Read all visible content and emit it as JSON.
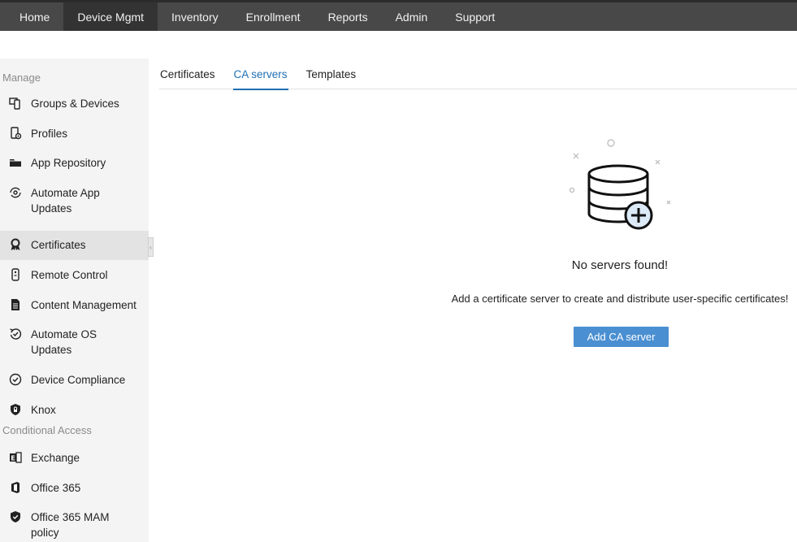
{
  "topnav": {
    "items": [
      "Home",
      "Device Mgmt",
      "Inventory",
      "Enrollment",
      "Reports",
      "Admin",
      "Support"
    ],
    "active": "Device Mgmt"
  },
  "sidebar": {
    "manage_label": "Manage",
    "manage_items": [
      {
        "label": "Groups & Devices",
        "icon": "devices-icon"
      },
      {
        "label": "Profiles",
        "icon": "profile-gear-icon"
      },
      {
        "label": "App Repository",
        "icon": "folder-icon"
      },
      {
        "label": "Automate App Updates",
        "icon": "sync-app-icon"
      },
      {
        "label": "Certificates",
        "icon": "certificate-icon"
      },
      {
        "label": "Remote Control",
        "icon": "remote-icon"
      },
      {
        "label": "Content Management",
        "icon": "document-icon"
      },
      {
        "label": "Automate OS Updates",
        "icon": "os-update-icon"
      },
      {
        "label": "Device Compliance",
        "icon": "check-circle-icon"
      },
      {
        "label": "Knox",
        "icon": "knox-shield-icon"
      }
    ],
    "conditional_label": "Conditional Access",
    "conditional_items": [
      {
        "label": "Exchange",
        "icon": "exchange-icon"
      },
      {
        "label": "Office 365",
        "icon": "office-icon"
      },
      {
        "label": "Office 365 MAM policy",
        "icon": "shield-check-icon"
      }
    ],
    "active": "Certificates"
  },
  "tabs": {
    "items": [
      "Certificates",
      "CA servers",
      "Templates"
    ],
    "active": "CA servers"
  },
  "empty_state": {
    "illustration_icon": "database-add-icon",
    "title": "No servers found!",
    "description": "Add a certificate server to create and distribute user-specific certificates!",
    "button_label": "Add CA server"
  },
  "colors": {
    "nav_bg": "#484848",
    "nav_active": "#333333",
    "accent": "#1f6fb2",
    "button": "#4a8fd1",
    "sidebar_bg": "#f4f4f4"
  }
}
